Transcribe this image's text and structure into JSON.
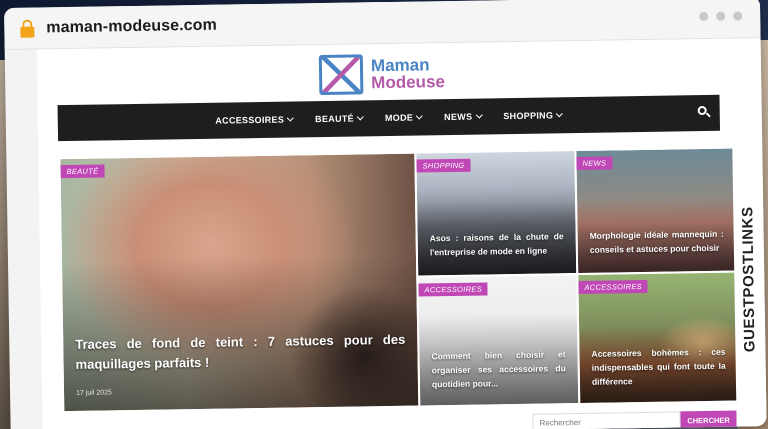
{
  "browser": {
    "url": "maman-modeuse.com"
  },
  "side_brand": {
    "text": "GUESTPOSTLINKS"
  },
  "site": {
    "logo_line1": "Maman",
    "logo_line2": "Modeuse",
    "accent_color": "#c048b6"
  },
  "nav": {
    "items": [
      {
        "label": "ACCESSOIRES"
      },
      {
        "label": "BEAUTÉ"
      },
      {
        "label": "MODE"
      },
      {
        "label": "NEWS"
      },
      {
        "label": "SHOPPING"
      }
    ]
  },
  "cards": [
    {
      "category": "BEAUTÉ",
      "title": "Traces de fond de teint : 7 astuces pour des maquillages parfaits !",
      "date": "17 juil 2025"
    },
    {
      "category": "SHOPPING",
      "title": "Asos : raisons de la chute de l'entreprise de mode en ligne"
    },
    {
      "category": "NEWS",
      "title": "Morphologie idéale mannequin : conseils et astuces pour choisir"
    },
    {
      "category": "ACCESSOIRES",
      "title": "Comment bien choisir et organiser ses accessoires du quotidien pour..."
    },
    {
      "category": "ACCESSOIRES",
      "title": "Accessoires bohèmes : ces indispensables qui font toute la différence"
    }
  ],
  "search": {
    "placeholder": "Rechercher",
    "button_label": "CHERCHER"
  }
}
